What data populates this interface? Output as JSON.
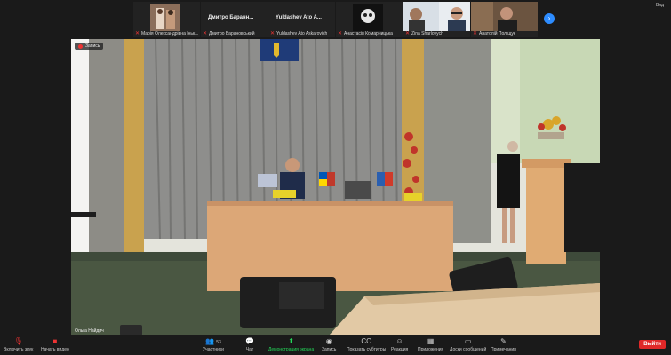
{
  "participants": [
    {
      "name": "",
      "label": "Марія Олександрівна Іньк...",
      "muted": true
    },
    {
      "name": "Дмитро Баранн...",
      "label": "Дмитро Барановський",
      "muted": true
    },
    {
      "name": "Yuldashev Ato A...",
      "label": "Yuldashev Ato Askarovich",
      "muted": true
    },
    {
      "name": "",
      "label": "Анастасія Комарницька",
      "muted": true
    },
    {
      "name": "",
      "label": "Zina Sharlovych",
      "muted": true
    },
    {
      "name": "",
      "label": "Анатолій Поліщук",
      "muted": true
    }
  ],
  "next_icon": "chevron-right-icon",
  "view_label": "Вид",
  "recording_label": "Запись",
  "active_speaker": "Ольга Найдич",
  "toolbar": {
    "unmute": "Включить звук",
    "start_video": "Начать видео",
    "participants": "Участники",
    "participants_count": "53",
    "chat": "Чат",
    "share": "Демонстрация экрана",
    "record": "Запись",
    "captions": "Показать субтитры",
    "reactions": "Реакция",
    "apps": "Приложения",
    "whiteboards": "Доски сообщений",
    "notes": "Примечания",
    "leave": "Выйти"
  },
  "colors": {
    "accent": "#2d8cff",
    "leave": "#e02828",
    "share": "#23d959"
  }
}
